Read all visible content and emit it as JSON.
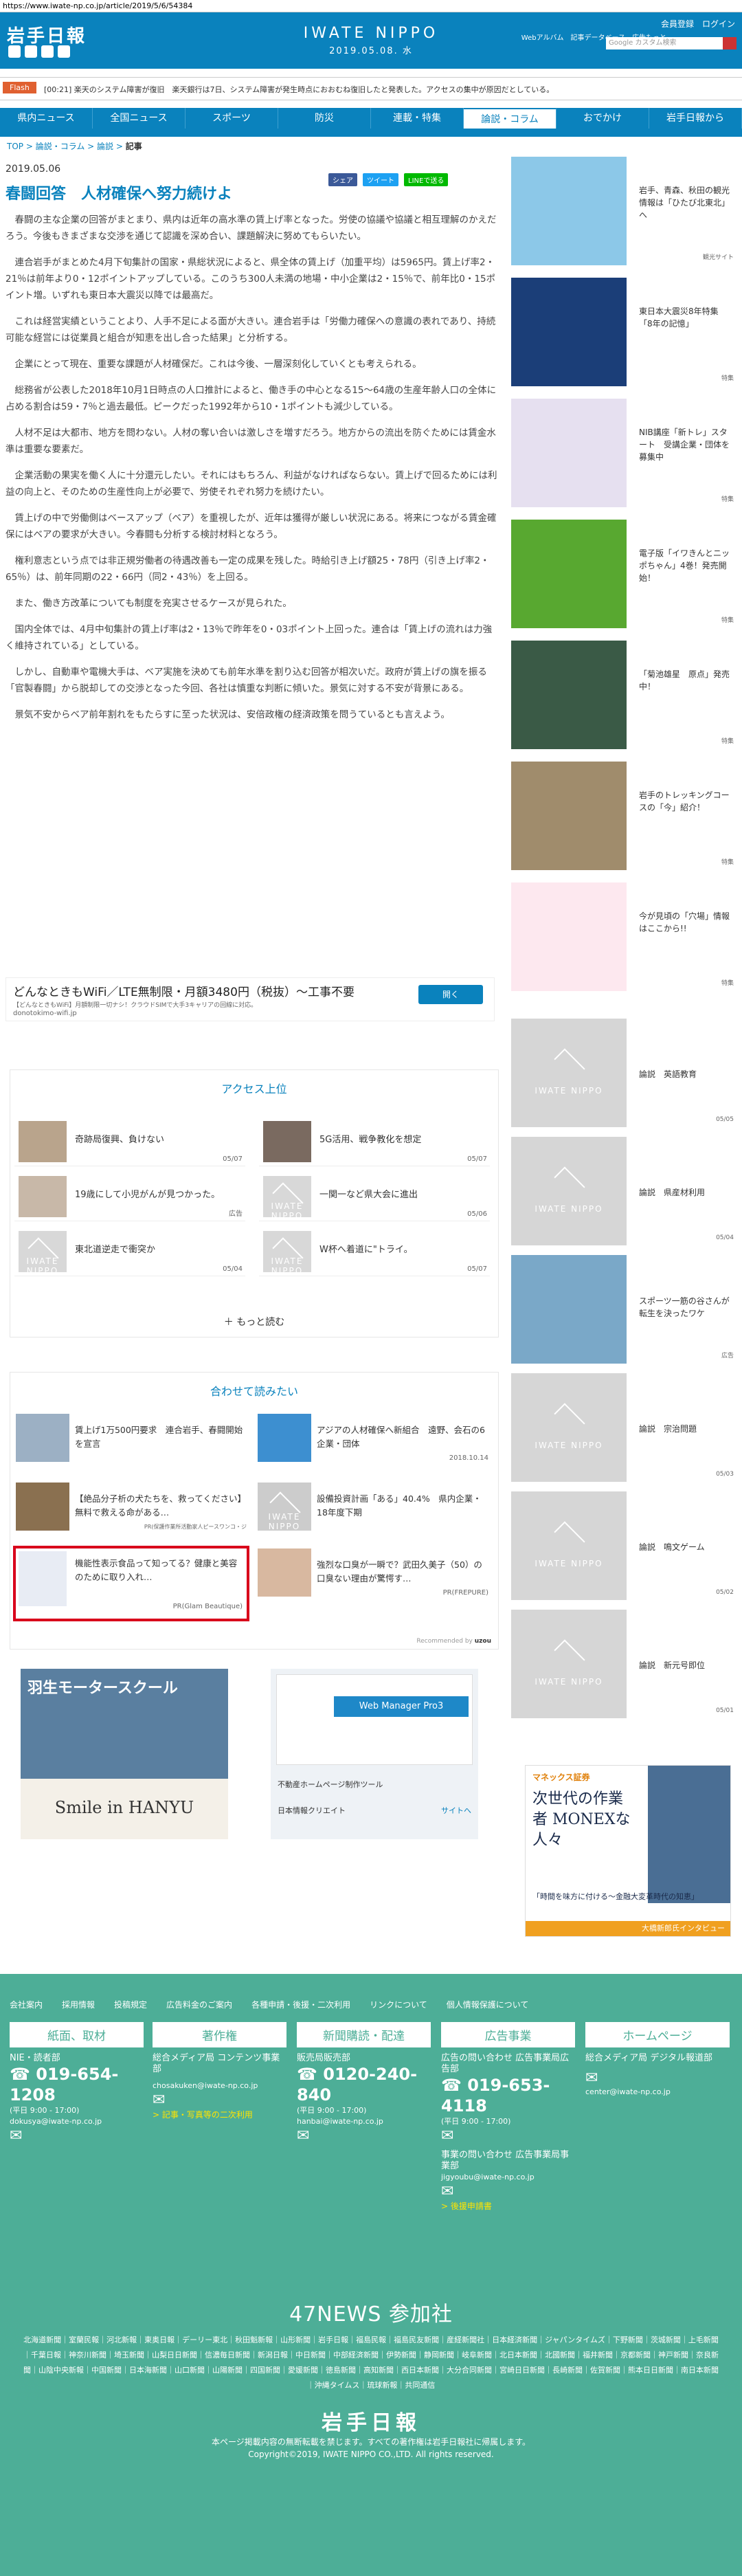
{
  "url": "https://www.iwate-np.co.jp/article/2019/5/6/54384",
  "header": {
    "logo": "岩手日報",
    "brand": "IWATE NIPPO",
    "date": "2019.05.08. 水",
    "links": "会員登録　ログイン",
    "links2": "Webアルバム　記事データベース　広告もっと",
    "search_placeholder": "Google カスタム検索"
  },
  "flash": {
    "label": "Flash",
    "text": "[00:21] 楽天のシステム障害が復旧　楽天銀行は7日、システム障害が発生時点におおむね復旧したと発表した。アクセスの集中が原因だとしている。"
  },
  "nav": [
    "県内ニュース",
    "全国ニュース",
    "スポーツ",
    "防災",
    "連載・特集",
    "論説・コラム",
    "おでかけ",
    "岩手日報から"
  ],
  "breadcrumb": {
    "top": "TOP",
    "section": "論説・コラム",
    "sub": "論説",
    "current": "記事"
  },
  "article": {
    "date": "2019.05.06",
    "share": [
      "シェア",
      "ツイート",
      "LINEで送る"
    ],
    "title": "春闘回答　人材確保へ努力続けよ",
    "paragraphs": [
      "春闘の主な企業の回答がまとまり、県内は近年の高水準の賃上げ率となった。労使の協議や協議と相互理解のかえだろう。今後もきまざまな交渉を通じて認識を深め合い、課題解決に努めてもらいたい。",
      "連合岩手がまとめた4月下旬集計の国家・県総状況によると、県全体の賃上げ（加重平均）は5965円。賃上げ率2・21％は前年より0・12ポイントアップしている。このうち300人未満の地場・中小企業は2・15％で、前年比0・15ポイント増。いずれも東日本大震災以降では最高だ。",
      "これは経営実績ということより、人手不足による面が大きい。連合岩手は「労働力確保への意識の表れであり、持続可能な経営には従業員と組合が知恵を出し合った結果」と分析する。",
      "企業にとって現在、重要な課題が人材確保だ。これは今後、一層深刻化していくとも考えられる。",
      "総務省が公表した2018年10月1日時点の人口推計によると、働き手の中心となる15〜64歳の生産年齢人口の全体に占める割合は59・7％と過去最低。ピークだった1992年から10・1ポイントも減少している。",
      "人材不足は大都市、地方を問わない。人材の奪い合いは激しさを増すだろう。地方からの流出を防ぐためには賃金水準は重要な要素だ。",
      "企業活動の果実を働く人に十分還元したい。それにはもちろん、利益がなければならない。賃上げで回るためには利益の向上と、そのための生産性向上が必要で、労使それぞれ努力を続けたい。",
      "賃上げの中で労働側はベースアップ（ベア）を重視したが、近年は獲得が厳しい状況にある。将来につながる賃金確保にはベアの要求が大きい。今春闘も分析する検討材料となろう。",
      "権利意志という点では非正規労働者の待遇改善も一定の成果を残した。時給引き上げ額25・78円（引き上げ率2・65％）は、前年同期の22・66円（同2・43％）を上回る。",
      "また、働き方改革についても制度を充実させるケースが見られた。",
      "国内全体では、4月中旬集計の賃上げ率は2・13％で昨年を0・03ポイント上回った。連合は「賃上げの流れは力強く維持されている」としている。",
      "しかし、自動車や電機大手は、ベア実施を決めても前年水準を割り込む回答が相次いだ。政府が賃上げの旗を振る「官製春闘」から脱却しての交渉となった今回、各社は慎重な判断に傾いた。景気に対する不安が背景にある。",
      "景気不安からベア前年割れをもたらすに至った状況は、安倍政権の経済政策を問うているとも言えよう。"
    ]
  },
  "ad": {
    "headline": "どんなときもWiFi／LTE無制限・月額3480円（税抜）〜工事不要",
    "sub": "【どんなときもWiFi】月額制限一切ナシ！クラウドSIMで大手3キャリアの回線に対応。",
    "url": "donotokimo-wifi.jp",
    "button": "開く"
  },
  "ranking": {
    "heading": "アクセス上位",
    "items": [
      {
        "title": "奇跡局復興、負けない",
        "date": "05/07"
      },
      {
        "title": "5G活用、戦争教化を想定",
        "date": "05/07"
      },
      {
        "title": "19歳にして小児がんが見つかった。",
        "date": "広告"
      },
      {
        "title": "一関一など県大会に進出",
        "date": "05/06"
      },
      {
        "title": "東北道逆走で衝突か",
        "date": "05/04"
      },
      {
        "title": "W杯へ着道に\"トライ。",
        "date": "05/07"
      }
    ],
    "more": "もっと読む"
  },
  "related": {
    "heading": "合わせて読みたい",
    "items": [
      {
        "title": "賃上げ1万500円要求　連合岩手、春闘開始を宣言",
        "date": ""
      },
      {
        "title": "アジアの人材確保へ新組合　遠野、会石の6企業・団体",
        "date": "2018.10.14"
      },
      {
        "title": "【絶品分子析の犬たちを、救ってください】無料で救える命がある…",
        "date": "PR(保護作業所活動家人ピースワンコ・ジ"
      },
      {
        "title": "設備投資計画「ある」40.4%　県内企業・18年度下期",
        "date": ""
      },
      {
        "title": "機能性表示食品って知ってる？健康と美容のために取り入れ…",
        "date": "PR(Glam Beautique)"
      },
      {
        "title": "強烈な口臭が一瞬で？武田久美子（50）の口臭ない理由が驚愕す…",
        "date": "PR(FREPURE)"
      }
    ],
    "recommended": "Recommended by"
  },
  "bottom_ads": {
    "left_title": "羽生モータースクール",
    "left_sub": "Smile in HANYU",
    "right_title": "不動産ホームページ制作ツール",
    "right_company": "日本情報クリエイト",
    "right_site": "サイトへ",
    "right_label": "Web Manager Pro3"
  },
  "sidebar": [
    {
      "title": "岩手、青森、秋田の観光情報は「ひたび北東北」へ",
      "credit": "観光サイト"
    },
    {
      "title": "東日本大震災8年特集　「8年の記憶」",
      "credit": "特集"
    },
    {
      "title": "NIB講座「新トレ」スタート　受講企業・団体を募集中",
      "credit": "特集"
    },
    {
      "title": "電子版「イワきんとニッポちゃん」4巻！発売開始！",
      "credit": "特集"
    },
    {
      "title": "「菊池雄星　原点」発売中！",
      "credit": "特集"
    },
    {
      "title": "岩手のトレッキングコースの「今」紹介！",
      "credit": "特集"
    },
    {
      "title": "今が見頃の「穴場」情報はここから!!",
      "credit": "特集"
    },
    {
      "title": "論説　英語教育",
      "credit": "05/05"
    },
    {
      "title": "論説　県産材利用",
      "credit": "05/04"
    },
    {
      "title": "スポーツ一筋の谷さんが転生を決ったワケ",
      "credit": "広告"
    },
    {
      "title": "論説　宗治問題",
      "credit": "05/03"
    },
    {
      "title": "論説　鳴文ゲーム",
      "credit": "05/02"
    },
    {
      "title": "論説　新元号即位",
      "credit": "05/01"
    }
  ],
  "side_ad": {
    "brand": "マネックス証券",
    "headline": "次世代の作業者 MONEXな人々",
    "sub": "「時間を味方に付ける〜金融大変革時代の知恵」",
    "footer": "大橋新郎氏インタビュー"
  },
  "footer": {
    "links": [
      "会社案内",
      "採用情報",
      "投稿規定",
      "広告料金のご案内",
      "各種申請・後援・二次利用",
      "リンクについて",
      "個人情報保護について"
    ],
    "columns": [
      {
        "head": "紙面、取材",
        "l1": "NIE・読者部",
        "tel": "019-654-1208",
        "hours": "(平日 9:00 - 17:00)",
        "mail": "dokusya@iwate-np.co.jp",
        "extra": ""
      },
      {
        "head": "著作権",
        "l1": "総合メディア局 コンテンツ事業部",
        "tel": "",
        "hours": "",
        "mail": "chosakuken@iwate-np.co.jp",
        "extra": "> 記事・写真等の二次利用"
      },
      {
        "head": "新聞購読・配達",
        "l1": "販売局販売部",
        "tel": "0120-240-840",
        "hours": "(平日 9:00 - 17:00)",
        "mail": "hanbai@iwate-np.co.jp",
        "extra": ""
      },
      {
        "head": "広告事業",
        "l1": "広告の問い合わせ 広告事業局広告部",
        "tel": "019-653-4118",
        "hours": "(平日 9:00 - 17:00)",
        "mail": "jigyoubu@iwate-np.co.jp",
        "extra": "> 後援申請書"
      },
      {
        "head": "ホームページ",
        "l1": "総合メディア局 デジタル報道部",
        "tel": "",
        "hours": "",
        "mail": "center@iwate-np.co.jp",
        "extra": ""
      }
    ],
    "ad_l2": "事業の問い合わせ 広告事業局事業部",
    "n47": "47NEWS 参加社",
    "papers": "北海道新聞｜室蘭民報｜河北新報｜東奥日報｜デーリー東北｜秋田魁新報｜山形新聞｜岩手日報｜福島民報｜福島民友新聞｜産経新聞社｜日本経済新聞｜ジャパンタイムズ｜下野新聞｜茨城新聞｜上毛新聞｜千葉日報｜神奈川新聞｜埼玉新聞｜山梨日日新聞｜信濃毎日新聞｜新潟日報｜中日新聞｜中部経済新聞｜伊勢新聞｜静岡新聞｜岐阜新聞｜北日本新聞｜北國新聞｜福井新聞｜京都新聞｜神戸新聞｜奈良新聞｜山陰中央新報｜中国新聞｜日本海新聞｜山口新聞｜山陽新聞｜四国新聞｜愛媛新聞｜徳島新聞｜高知新聞｜西日本新聞｜大分合同新聞｜宮崎日日新聞｜長崎新聞｜佐賀新聞｜熊本日日新聞｜南日本新聞｜沖縄タイムス｜琉球新報｜共同通信",
    "logo": "岩手日報",
    "copy1": "本ページ掲載内容の無断転載を禁じます。すべての著作権は岩手日報社に帰属します。",
    "copy2": "Copyright©2019, IWATE NIPPO CO.,LTD. All rights reserved."
  },
  "colors": {
    "brand": "#0a82bd",
    "footer": "#4dae97",
    "flash": "#e06030",
    "highlight": "#d9001b"
  }
}
